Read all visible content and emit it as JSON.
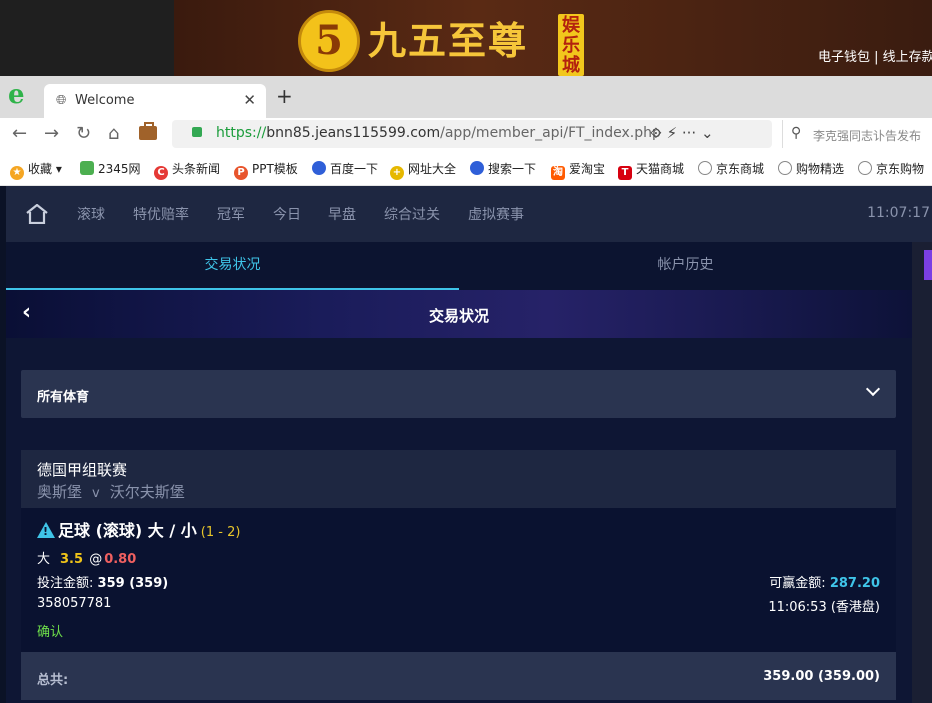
{
  "banner": {
    "logo_glyph": "5",
    "brand": "九五至尊",
    "seal": "娱乐城",
    "links": "电子钱包 | 线上存款"
  },
  "browser": {
    "logo": "e",
    "tab_title": "Welcome",
    "tab_close": "✕",
    "new_tab": "+",
    "url_proto": "https://",
    "url_host": "bnn85.jeans115599.com",
    "url_path": "/app/member_api/FT_index.php",
    "url_tools": "⟐  ⚡  ···  ⌄",
    "search_placeholder": "李克强同志讣告发布",
    "bookmarks": [
      {
        "label": "收藏",
        "icon": "star-icon",
        "color": "#f5a623"
      },
      {
        "label": "2345网",
        "icon": "2345-icon",
        "color": "#4caf50"
      },
      {
        "label": "头条新闻",
        "icon": "toutiao-icon",
        "color": "#e53935"
      },
      {
        "label": "PPT模板",
        "icon": "ppt-icon",
        "color": "#e8552d"
      },
      {
        "label": "百度一下",
        "icon": "baidu-paw-icon",
        "color": "#2f5fd8"
      },
      {
        "label": "网址大全",
        "icon": "plus-icon",
        "color": "#e6b800"
      },
      {
        "label": "搜索一下",
        "icon": "baidu-paw-icon",
        "color": "#2f5fd8"
      },
      {
        "label": "爱淘宝",
        "icon": "taobao-icon",
        "color": "#ff5a00"
      },
      {
        "label": "天猫商城",
        "icon": "tmall-icon",
        "color": "#d7000f"
      },
      {
        "label": "京东商城",
        "icon": "globe-icon",
        "color": "#888888"
      },
      {
        "label": "购物精选",
        "icon": "globe-icon",
        "color": "#888888"
      },
      {
        "label": "京东购物",
        "icon": "globe-icon",
        "color": "#888888"
      }
    ]
  },
  "nav": {
    "items": [
      "滚球",
      "特优赔率",
      "冠军",
      "今日",
      "早盘",
      "综合过关",
      "虚拟赛事"
    ],
    "clock": "11:07:17"
  },
  "tabs": {
    "active": "交易状况",
    "inactive": "帐户历史"
  },
  "page": {
    "back": "‹",
    "title": "交易状况"
  },
  "filter": {
    "selected": "所有体育"
  },
  "bet": {
    "league": "德国甲组联赛",
    "home": "奥斯堡",
    "vs": "v",
    "away": "沃尔夫斯堡",
    "market": "足球 (滚球) 大 / 小",
    "score": "(1 - 2)",
    "selection": "大",
    "handicap": "3.5",
    "at": "@",
    "odds": "0.80",
    "stake_label": "投注金额:",
    "stake_value": "359 (359)",
    "win_label": "可赢金额:",
    "win_value": "287.20",
    "ticket_id": "358057781",
    "time": "11:06:53 (香港盘)",
    "status": "确认"
  },
  "total": {
    "label": "总共:",
    "value": "359.00 (359.00)"
  }
}
